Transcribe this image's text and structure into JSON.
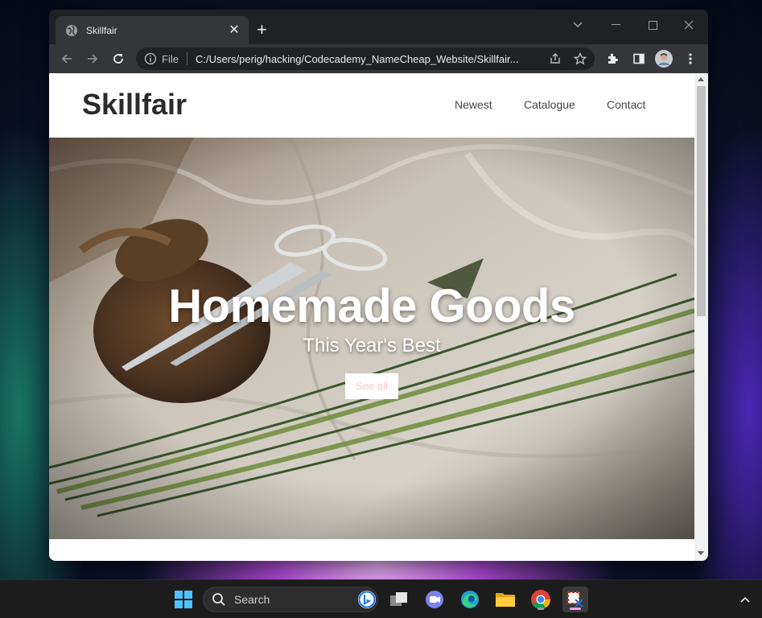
{
  "browser": {
    "tab_title": "Skillfair",
    "new_tab_label": "+",
    "address_scheme_label": "File",
    "url": "C:/Users/perig/hacking/Codecademy_NameCheap_Website/Skillfair..."
  },
  "site": {
    "logo": "Skillfair",
    "nav": [
      "Newest",
      "Catalogue",
      "Contact"
    ],
    "hero": {
      "title": "Homemade Goods",
      "subtitle": "This Year's Best",
      "button": "See all"
    }
  },
  "taskbar": {
    "search_label": "Search"
  },
  "colors": {
    "accent_button_text": "#f5c6c6",
    "browser_frame": "#202124",
    "toolbar": "#35363a"
  }
}
